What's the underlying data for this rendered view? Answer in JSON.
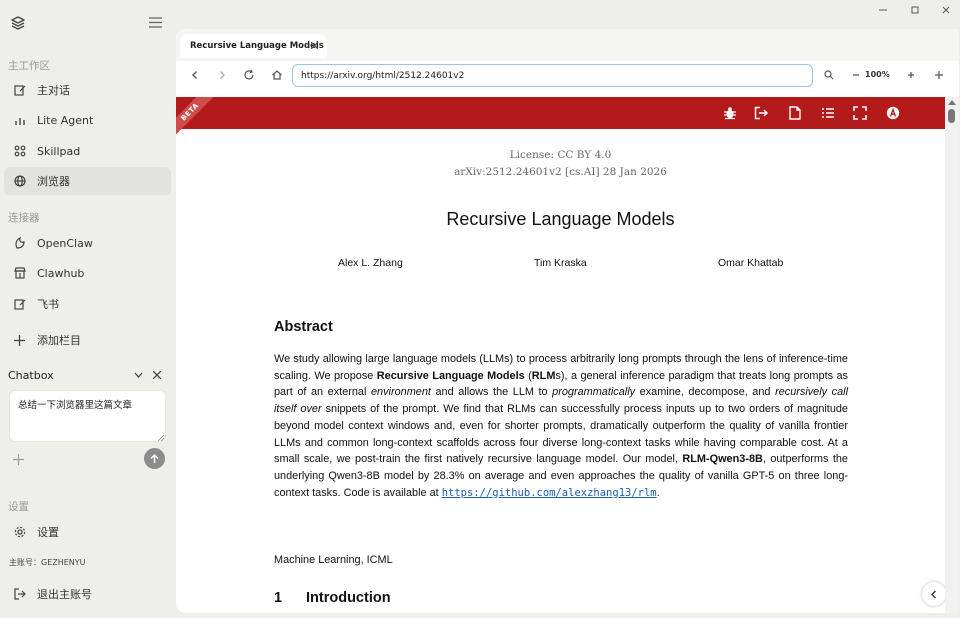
{
  "sidebar": {
    "workspace_heading": "主工作区",
    "items": [
      {
        "label": "主对话",
        "icon": "edit-icon"
      },
      {
        "label": "Lite Agent",
        "icon": "bar-chart-icon"
      },
      {
        "label": "Skillpad",
        "icon": "grid-icon"
      },
      {
        "label": "浏览器",
        "icon": "globe-icon"
      }
    ],
    "connectors_heading": "连接器",
    "connectors": [
      {
        "label": "OpenClaw",
        "icon": "claw-icon"
      },
      {
        "label": "Clawhub",
        "icon": "store-icon"
      },
      {
        "label": "飞书",
        "icon": "edit-icon"
      }
    ],
    "add_column_label": "添加栏目",
    "chatbox": {
      "title": "Chatbox",
      "input_value": "总结一下浏览器里这篇文章"
    },
    "settings_heading": "设置",
    "settings_label": "设置",
    "account_label": "主账号：GEZHENYU",
    "logout_label": "退出主账号"
  },
  "browser": {
    "tab_title": "Recursive Language Models",
    "url": "https://arxiv.org/html/2512.24601v2",
    "zoom": "100%"
  },
  "page": {
    "beta_label": "BETA",
    "license": "License: CC BY 4.0",
    "arxiv_id": "arXiv:2512.24601v2 [cs.AI] 28 Jan 2026",
    "title": "Recursive Language Models",
    "authors": [
      "Alex L. Zhang",
      "Tim Kraska",
      "Omar Khattab"
    ],
    "abstract_heading": "Abstract",
    "abstract": {
      "p1": "We study allowing large language models (LLMs) to process arbitrarily long prompts through the lens of inference-time scaling. We propose ",
      "b1": "Recursive Language Models",
      "p2": " (",
      "b2": "RLM",
      "p3": "s), a general inference paradigm that treats long prompts as part of an external ",
      "i1": "environment",
      "p4": " and allows the LLM to ",
      "i2": "programmatically",
      "p5": " examine, decompose, and ",
      "i3": "recursively call itself over",
      "p6": " snippets of the prompt. We find that RLMs can successfully process inputs up to two orders of magnitude beyond model context windows and, even for shorter prompts, dramatically outperform the quality of vanilla frontier LLMs and common long-context scaffolds across four diverse long-context tasks while having comparable cost. At a small scale, we post-train the first natively recursive language model. Our model, ",
      "b3": "RLM-Qwen3-8B",
      "p7": ", outperforms the underlying Qwen3-8B model by 28.3% on average and even approaches the quality of vanilla GPT-5 on three long-context tasks. Code is available at ",
      "link": "https://github.com/alexzhang13/rlm",
      "p8": "."
    },
    "keywords": "Machine Learning, ICML",
    "section_number": "1",
    "section_title": "Introduction"
  },
  "colors": {
    "arxiv_red": "#b31b1b",
    "url_border": "#9cc4e4",
    "link": "#1a5fb4"
  }
}
